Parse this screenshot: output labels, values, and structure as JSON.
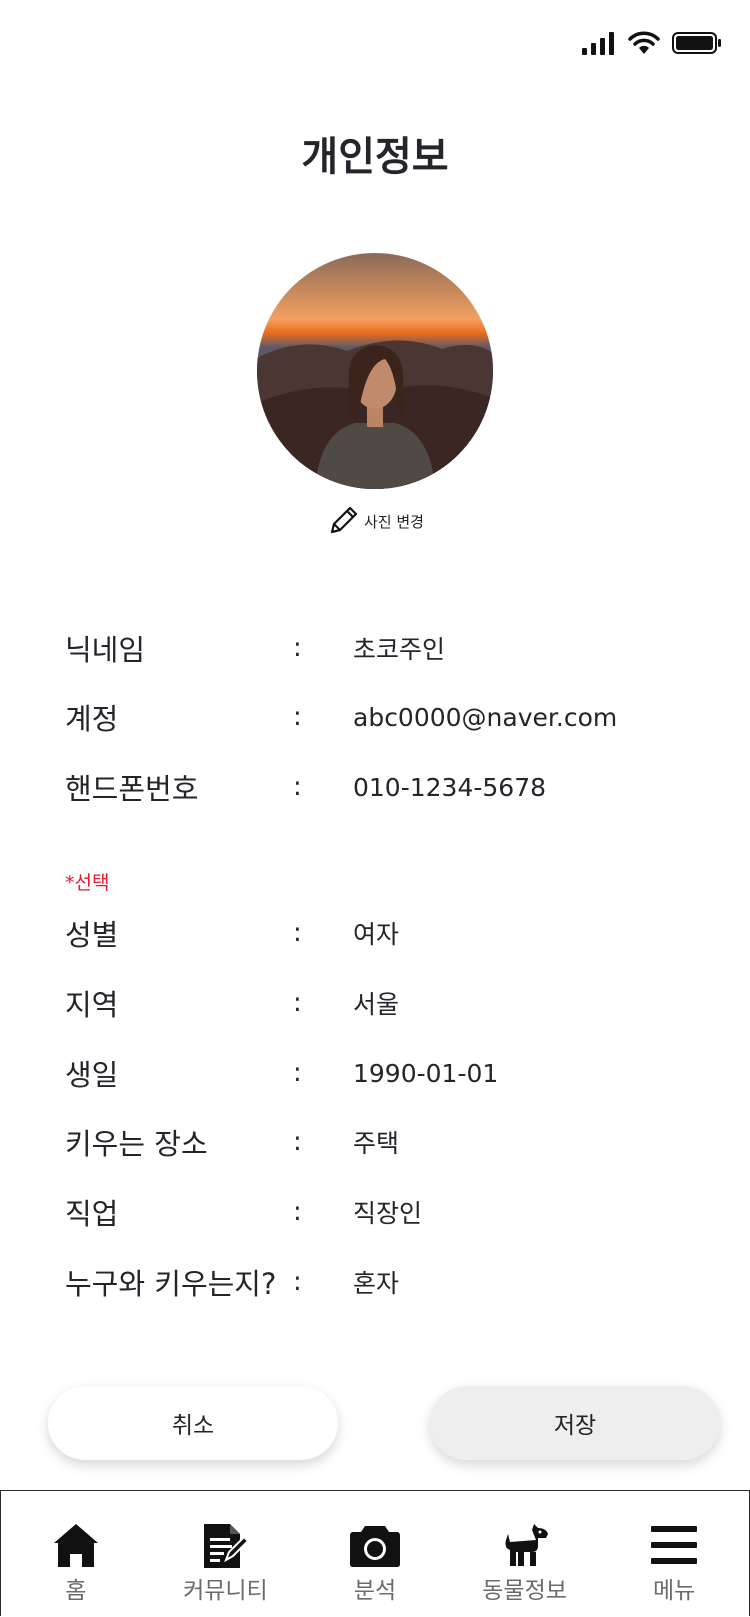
{
  "page": {
    "title": "개인정보"
  },
  "status_bar": {
    "icons": [
      "signal-icon",
      "wifi-icon",
      "battery-icon"
    ]
  },
  "profile": {
    "avatar_alt": "profile photo",
    "edit_label": "사진 변경"
  },
  "fields": [
    {
      "label": "닉네임",
      "colon": ":",
      "value": "초코주인"
    },
    {
      "label": "계정",
      "colon": ":",
      "value": "abc0000@naver.com"
    },
    {
      "label": "핸드폰번호",
      "colon": ":",
      "value": "010-1234-5678"
    }
  ],
  "optional_label": "*선택",
  "optional_fields": [
    {
      "label": "성별",
      "colon": ":",
      "value": "여자"
    },
    {
      "label": "지역",
      "colon": ":",
      "value": "서울"
    },
    {
      "label": "생일",
      "colon": ":",
      "value": "1990-01-01"
    },
    {
      "label": "키우는 장소",
      "colon": ":",
      "value": "주택"
    },
    {
      "label": "직업",
      "colon": ":",
      "value": "직장인"
    },
    {
      "label": "누구와 키우는지?",
      "colon": ":",
      "value": "혼자"
    }
  ],
  "buttons": {
    "cancel": "취소",
    "save": "저장"
  },
  "nav": [
    {
      "label": "홈",
      "icon": "home-icon"
    },
    {
      "label": "커뮤니티",
      "icon": "community-icon"
    },
    {
      "label": "분석",
      "icon": "camera-icon"
    },
    {
      "label": "동물정보",
      "icon": "dog-icon"
    },
    {
      "label": "메뉴",
      "icon": "menu-icon"
    }
  ],
  "colors": {
    "text": "#23252b",
    "optional": "#e8192c",
    "nav_label": "#6b6b6b",
    "save_bg": "#eeeeee"
  }
}
